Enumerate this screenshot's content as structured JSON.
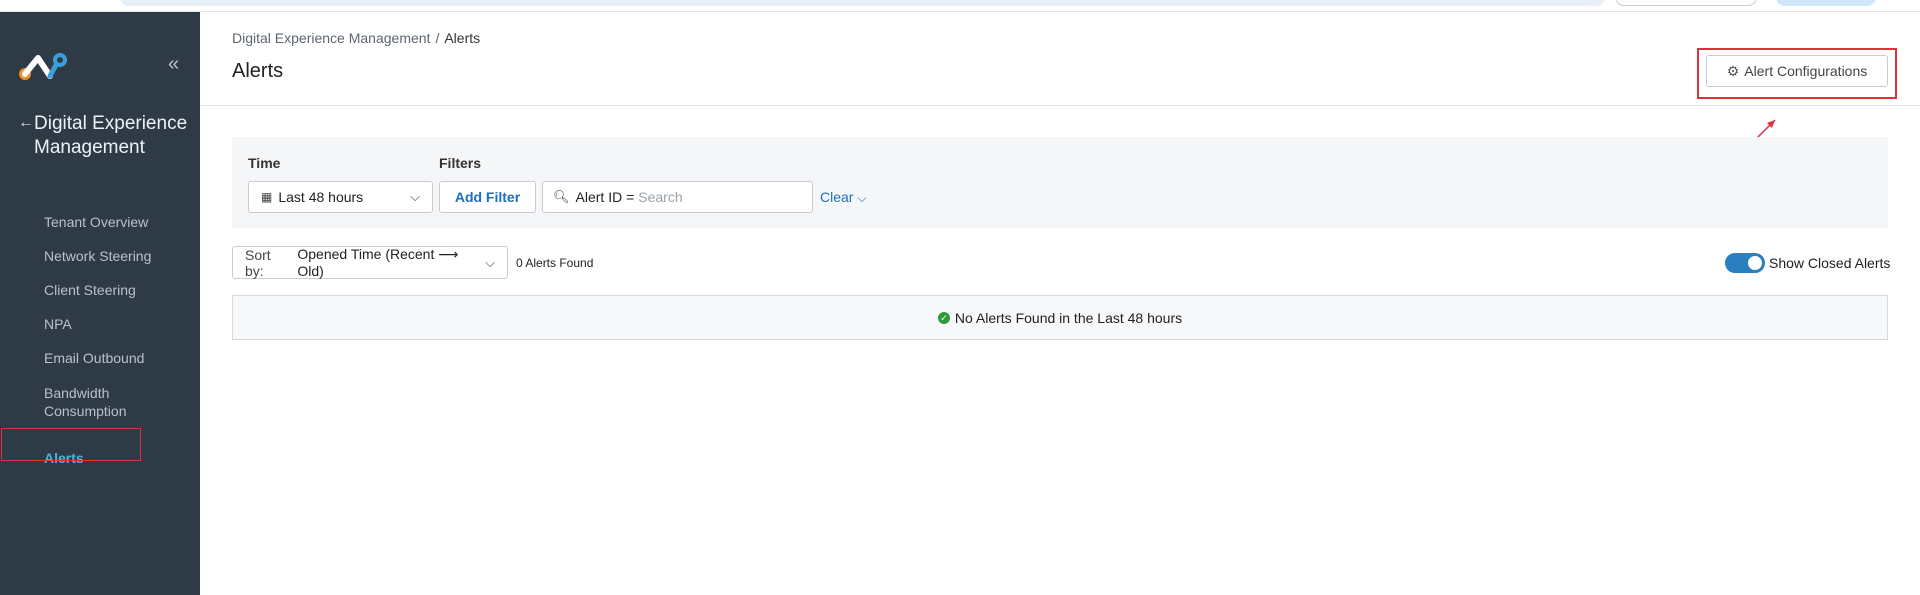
{
  "sidebar": {
    "section_title": "Digital Experience Management",
    "items": [
      {
        "label": "Tenant Overview"
      },
      {
        "label": "Network Steering"
      },
      {
        "label": "Client Steering"
      },
      {
        "label": "NPA"
      },
      {
        "label": "Email Outbound"
      },
      {
        "label": "Bandwidth Consumption"
      },
      {
        "label": "Alerts",
        "active": true
      }
    ]
  },
  "breadcrumb": {
    "parent": "Digital Experience Management",
    "separator": "/",
    "current": "Alerts"
  },
  "page": {
    "title": "Alerts",
    "config_button": "Alert Configurations"
  },
  "filters": {
    "time_label": "Time",
    "time_value": "Last 48 hours",
    "filters_label": "Filters",
    "add_filter": "Add Filter",
    "alert_id_label": "Alert ID =",
    "search_placeholder": "Search",
    "clear": "Clear"
  },
  "results": {
    "sort_label": "Sort by:",
    "sort_value": "Opened Time (Recent ⟶ Old)",
    "count": "0 Alerts Found",
    "toggle_label": "Show Closed Alerts",
    "toggle_on": true,
    "empty_message": "No Alerts Found in the Last 48 hours"
  },
  "colors": {
    "sidebar_bg": "#2e3a46",
    "accent": "#1e6fbf",
    "active_nav": "#4fb3e8",
    "highlight": "#e0303a",
    "success": "#2d9b3c"
  },
  "icons": [
    "logo-icon",
    "collapse-icon",
    "back-arrow-icon",
    "gear-icon",
    "calendar-icon",
    "chevron-down-icon",
    "search-icon",
    "check-circle-icon"
  ]
}
